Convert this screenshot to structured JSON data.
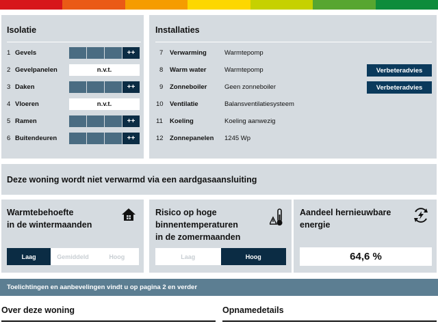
{
  "energy_stripe_colors": [
    "#d7161b",
    "#ea5a16",
    "#f59c00",
    "#fdd700",
    "#c6d100",
    "#57a630",
    "#0e8c3b"
  ],
  "isolatie": {
    "title": "Isolatie",
    "rows": [
      {
        "num": "1",
        "label": "Gevels",
        "rating": "++"
      },
      {
        "num": "2",
        "label": "Gevelpanelen",
        "rating": "n.v.t."
      },
      {
        "num": "3",
        "label": "Daken",
        "rating": "++"
      },
      {
        "num": "4",
        "label": "Vloeren",
        "rating": "n.v.t."
      },
      {
        "num": "5",
        "label": "Ramen",
        "rating": "++"
      },
      {
        "num": "6",
        "label": "Buitendeuren",
        "rating": "++"
      }
    ]
  },
  "installaties": {
    "title": "Installaties",
    "rows": [
      {
        "num": "7",
        "label": "Verwarming",
        "value": "Warmtepomp"
      },
      {
        "num": "8",
        "label": "Warm water",
        "value": "Warmtepomp",
        "button": "Verbeteradvies"
      },
      {
        "num": "9",
        "label": "Zonneboiler",
        "value": "Geen zonneboiler",
        "button": "Verbeteradvies"
      },
      {
        "num": "10",
        "label": "Ventilatie",
        "value": "Balansventilatiesysteem"
      },
      {
        "num": "11",
        "label": "Koeling",
        "value": "Koeling aanwezig"
      },
      {
        "num": "12",
        "label": "Zonnepanelen",
        "value": "1245 Wp"
      }
    ]
  },
  "gas_notice": "Deze woning wordt niet verwarmd via een aardgasaansluiting",
  "warmtebehoefte": {
    "title_line1": "Warmtebehoefte",
    "title_line2": "in de wintermaanden",
    "scale": [
      "Laag",
      "Gemiddeld",
      "Hoog"
    ],
    "selected": "Laag"
  },
  "risico": {
    "title_line1": "Risico op hoge",
    "title_line2": "binnentemperaturen",
    "title_line3": "in de zomermaanden",
    "scale": [
      "Laag",
      "Hoog"
    ],
    "selected": "Hoog"
  },
  "hernieuwbaar": {
    "title_line1": "Aandeel hernieuwbare",
    "title_line2": "energie",
    "value": "64,6 %"
  },
  "banner": "Toelichtingen en aanbevelingen vindt u op pagina 2 en verder",
  "footer": {
    "left_title": "Over deze woning",
    "right_title": "Opnamedetails"
  },
  "colors": {
    "panel": "#d5dbe0",
    "dark_navy": "#0b2c44",
    "bar_segment": "#4a6c82",
    "banner": "#5c7e92"
  }
}
